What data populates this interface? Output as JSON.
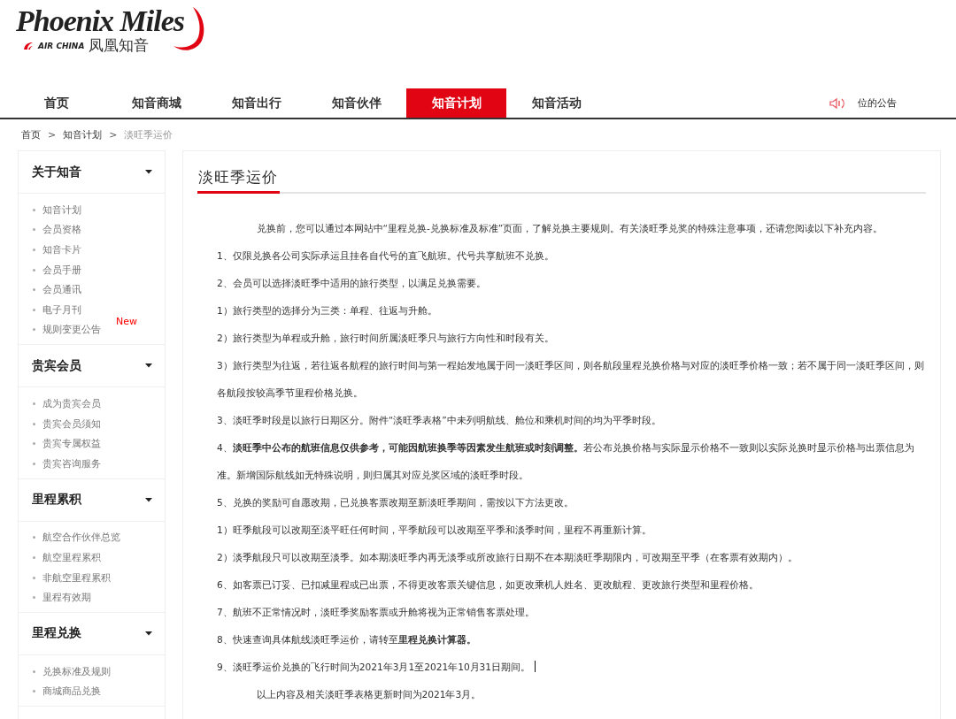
{
  "logo": {
    "script": "Phoenix Miles",
    "airline": "AIR CHINA",
    "brand": "凤凰知音"
  },
  "nav": [
    {
      "label": "首页",
      "selected": false
    },
    {
      "label": "知音商城",
      "selected": false
    },
    {
      "label": "知音出行",
      "selected": false
    },
    {
      "label": "知音伙伴",
      "selected": false
    },
    {
      "label": "知音计划",
      "selected": true
    },
    {
      "label": "知音活动",
      "selected": false
    }
  ],
  "announcement": "位的公告",
  "breadcrumb": [
    {
      "label": "首页",
      "current": false
    },
    {
      "label": "知音计划",
      "current": false
    },
    {
      "label": "淡旺季运价",
      "current": true
    }
  ],
  "breadcrumb_separator": ">",
  "sidebar": [
    {
      "title": "关于知音",
      "items": [
        {
          "label": "知音计划"
        },
        {
          "label": "会员资格"
        },
        {
          "label": "知音卡片"
        },
        {
          "label": "会员手册"
        },
        {
          "label": "会员通讯"
        },
        {
          "label": "电子月刊"
        },
        {
          "label": "规则变更公告",
          "badge": "New"
        }
      ]
    },
    {
      "title": "贵宾会员",
      "items": [
        {
          "label": "成为贵宾会员"
        },
        {
          "label": "贵宾会员须知"
        },
        {
          "label": "贵宾专属权益"
        },
        {
          "label": "贵宾咨询服务"
        }
      ]
    },
    {
      "title": "里程累积",
      "items": [
        {
          "label": "航空合作伙伴总览"
        },
        {
          "label": "航空里程累积"
        },
        {
          "label": "非航空里程累积"
        },
        {
          "label": "里程有效期"
        }
      ]
    },
    {
      "title": "里程兑换",
      "items": [
        {
          "label": "兑换标准及规则"
        },
        {
          "label": "商城商品兑换"
        }
      ]
    }
  ],
  "article": {
    "title": "淡旺季运价",
    "paragraphs": [
      {
        "kind": "indent",
        "text": "兑换前，您可以通过本网站中“里程兑换-兑换标准及标准”页面，了解兑换主要规则。有关淡旺季兑奖的特殊注意事项，还请您阅读以下补充内容。"
      },
      {
        "kind": "plain",
        "text": "1、仅限兑换各公司实际承运且挂各自代号的直飞航班。代号共享航班不兑换。"
      },
      {
        "kind": "plain",
        "text": "2、会员可以选择淡旺季中适用的旅行类型，以满足兑换需要。"
      },
      {
        "kind": "plain",
        "text": "1）旅行类型的选择分为三类：单程、往返与升舱。"
      },
      {
        "kind": "plain",
        "text": "2）旅行类型为单程或升舱，旅行时间所属淡旺季只与旅行方向性和时段有关。"
      },
      {
        "kind": "plain",
        "text": "3）旅行类型为往返，若往返各航程的旅行时间与第一程始发地属于同一淡旺季区间，则各航段里程兑换价格与对应的淡旺季价格一致；若不属于同一淡旺季区间，则各航段按较高季节里程价格兑换。"
      },
      {
        "kind": "plain",
        "text": "3、淡旺季时段是以旅行日期区分。附件“淡旺季表格”中未列明航线、舱位和乘机时间的均为平季时段。"
      },
      {
        "kind": "plain",
        "text": "4、**淡旺季中公布的航班信息仅供参考，可能因航班换季等因素发生航班或时刻调整。**若公布兑换价格与实际显示价格不一致则以实际兑换时显示价格与出票信息为准。新增国际航线如无特殊说明，则归属其对应兑奖区域的淡旺季时段。"
      },
      {
        "kind": "plain",
        "text": "5、兑换的奖励可自愿改期，已兑换客票改期至新淡旺季期间，需按以下方法更改。"
      },
      {
        "kind": "plain",
        "text": "1）旺季航段可以改期至淡平旺任何时间，平季航段可以改期至平季和淡季时间，里程不再重新计算。"
      },
      {
        "kind": "plain",
        "text": "2）淡季航段只可以改期至淡季。如本期淡旺季内再无淡季或所改旅行日期不在本期淡旺季期限内，可改期至平季（在客票有效期内）。"
      },
      {
        "kind": "plain",
        "text": "6、如客票已订妥、已扣减里程或已出票，不得更改客票关键信息，如更改乘机人姓名、更改航程、更改旅行类型和里程价格。"
      },
      {
        "kind": "plain",
        "text": "7、航班不正常情况时，淡旺季奖励客票或升舱将视为正常销售客票处理。"
      },
      {
        "kind": "plain",
        "text": "8、快速查询具体航线淡旺季运价，请转至**里程兑换计算器。**"
      },
      {
        "kind": "cursor",
        "text": "9、淡旺季运价兑换的飞行时间为2021年3月1至2021年10月31日期间。"
      },
      {
        "kind": "indent",
        "text": "以上内容及相关淡旺季表格更新时间为2021年3月。"
      }
    ]
  }
}
